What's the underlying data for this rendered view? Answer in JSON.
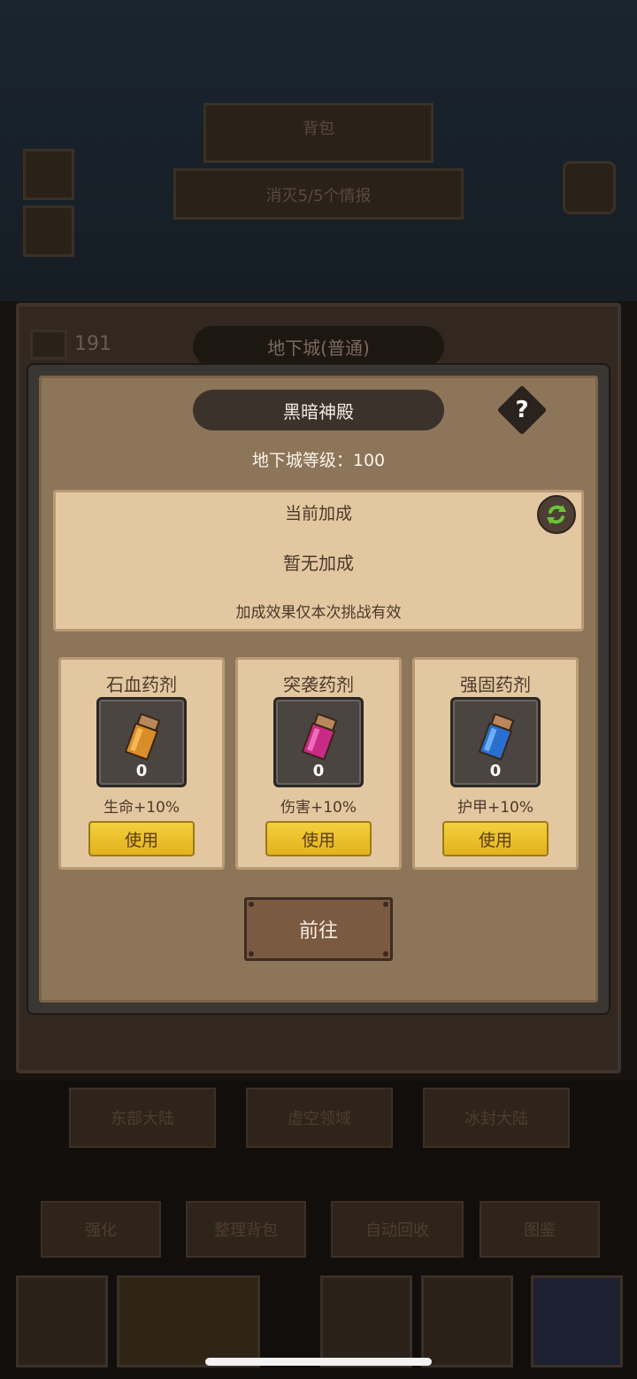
{
  "background": {
    "banner_top": "背包",
    "banner_quest": "消灭5/5个情报",
    "outer_title": "地下城(普通)",
    "resource_count": "191",
    "regions": [
      "东部大陆",
      "虚空领域",
      "冰封大陆"
    ],
    "bottom_tabs": [
      "强化",
      "整理背包",
      "自动回收",
      "图鉴"
    ]
  },
  "dialog": {
    "title": "黑暗神殿",
    "help_label": "?",
    "level_text": "地下城等级：100",
    "bonus": {
      "title": "当前加成",
      "value": "暂无加成",
      "note": "加成效果仅本次挑战有效"
    },
    "potions": [
      {
        "name": "石血药剂",
        "count": "0",
        "effect": "生命+10%",
        "use_label": "使用",
        "color": "#c97a2a"
      },
      {
        "name": "突袭药剂",
        "count": "0",
        "effect": "伤害+10%",
        "use_label": "使用",
        "color": "#c2287a"
      },
      {
        "name": "强固药剂",
        "count": "0",
        "effect": "护甲+10%",
        "use_label": "使用",
        "color": "#2a6fc9"
      }
    ],
    "go_label": "前往"
  },
  "colors": {
    "panel_bg": "#8d7559",
    "card_bg": "#e3c7a0",
    "use_button": "#f0c530",
    "go_button": "#7b5a42"
  }
}
